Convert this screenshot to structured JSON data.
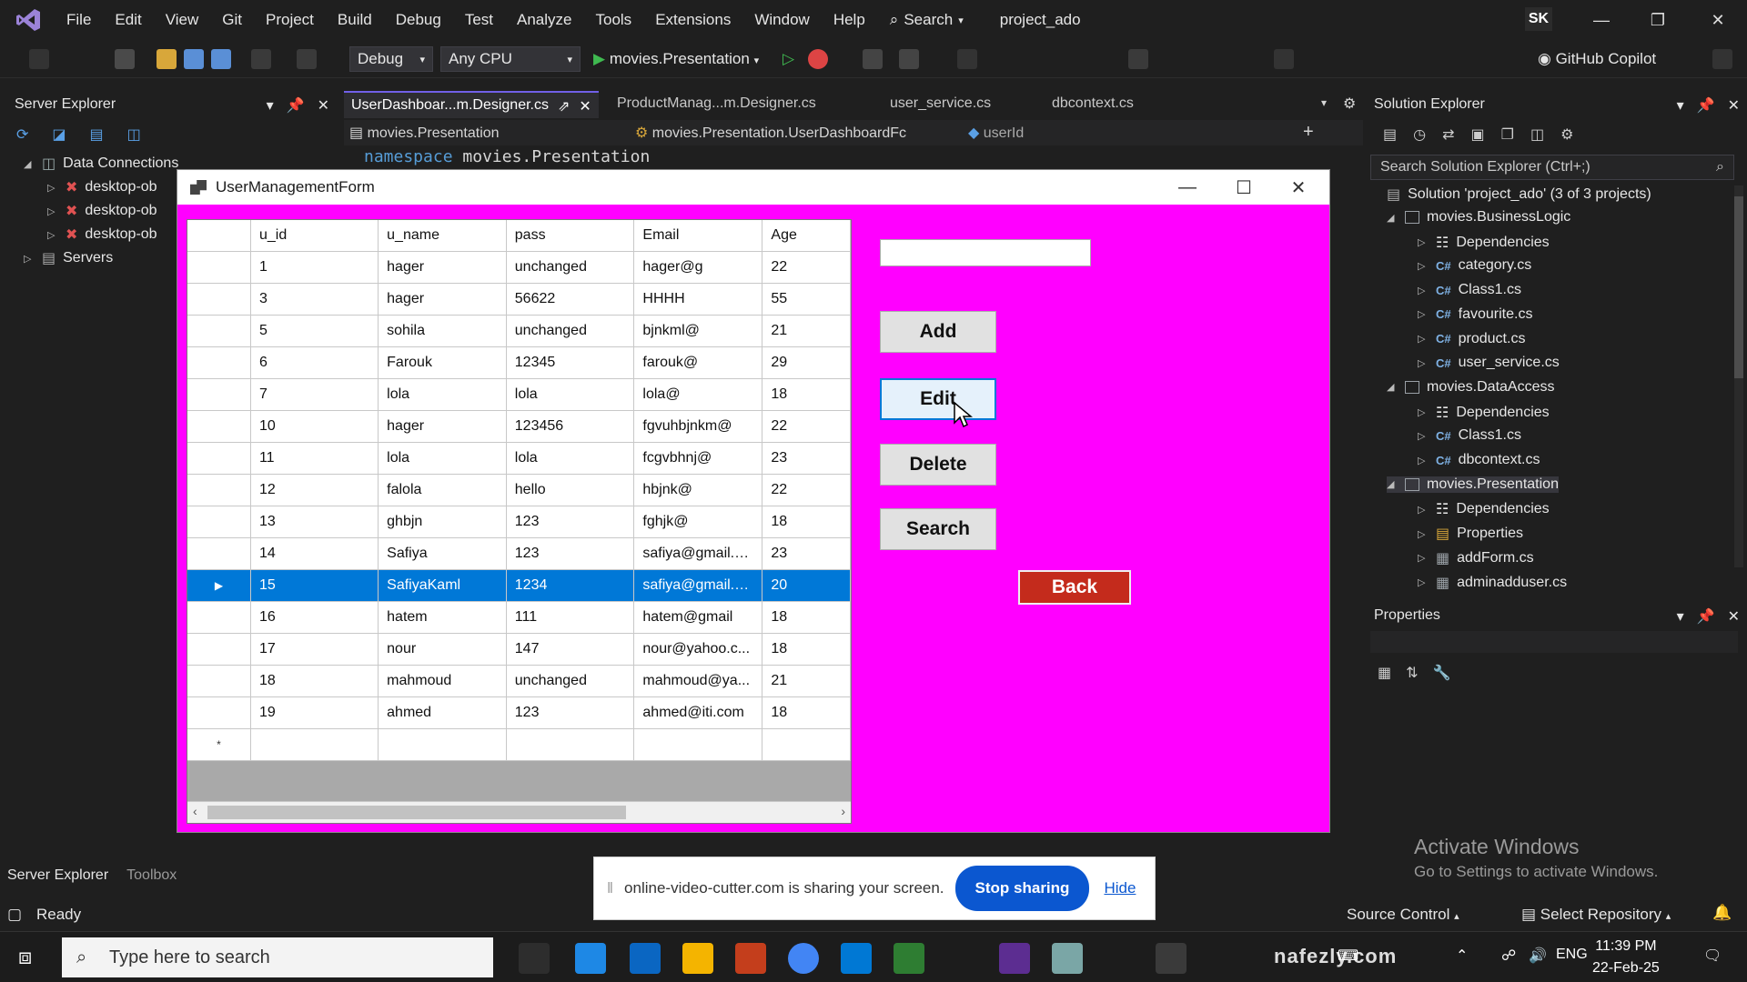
{
  "menu": {
    "items": [
      "File",
      "Edit",
      "View",
      "Git",
      "Project",
      "Build",
      "Debug",
      "Test",
      "Analyze",
      "Tools",
      "Extensions",
      "Window",
      "Help"
    ],
    "search_label": "Search",
    "project_title": "project_ado",
    "user_initials": "SK"
  },
  "toolbar": {
    "config": "Debug",
    "platform": "Any CPU",
    "startup_project": "movies.Presentation",
    "copilot": "GitHub Copilot"
  },
  "server_explorer": {
    "title": "Server Explorer",
    "data_connections": "Data Connections",
    "connections": [
      "desktop-ob",
      "desktop-ob",
      "desktop-ob"
    ],
    "servers": "Servers"
  },
  "editor": {
    "tabs": [
      "UserDashboar...m.Designer.cs",
      "ProductManag...m.Designer.cs",
      "user_service.cs",
      "dbcontext.cs"
    ],
    "nav_project": "movies.Presentation",
    "nav_class": "movies.Presentation.UserDashboardFc",
    "nav_member": "userId",
    "code_keyword": "namespace",
    "code_name": "movies.Presentation"
  },
  "solution_explorer": {
    "title": "Solution Explorer",
    "search_placeholder": "Search Solution Explorer (Ctrl+;)",
    "solution": "Solution 'project_ado' (3 of 3 projects)",
    "items": [
      {
        "label": "movies.BusinessLogic",
        "kind": "project"
      },
      {
        "label": "Dependencies",
        "kind": "deps"
      },
      {
        "label": "category.cs",
        "kind": "cs"
      },
      {
        "label": "Class1.cs",
        "kind": "cs"
      },
      {
        "label": "favourite.cs",
        "kind": "cs"
      },
      {
        "label": "product.cs",
        "kind": "cs"
      },
      {
        "label": "user_service.cs",
        "kind": "cs"
      },
      {
        "label": "movies.DataAccess",
        "kind": "project"
      },
      {
        "label": "Dependencies",
        "kind": "deps"
      },
      {
        "label": "Class1.cs",
        "kind": "cs"
      },
      {
        "label": "dbcontext.cs",
        "kind": "cs"
      },
      {
        "label": "movies.Presentation",
        "kind": "project"
      },
      {
        "label": "Dependencies",
        "kind": "deps"
      },
      {
        "label": "Properties",
        "kind": "folder"
      },
      {
        "label": "addForm.cs",
        "kind": "form"
      },
      {
        "label": "adminadduser.cs",
        "kind": "form"
      }
    ]
  },
  "properties": {
    "title": "Properties"
  },
  "activate_windows": {
    "line1": "Activate Windows",
    "line2": "Go to Settings to activate Windows."
  },
  "bottom_tabs": [
    "Server Explorer",
    "Toolbox"
  ],
  "status": {
    "ready": "Ready",
    "source_control": "Source Control",
    "select_repo": "Select Repository"
  },
  "form": {
    "title": "UserManagementForm",
    "columns": [
      "u_id",
      "u_name",
      "pass",
      "Email",
      "Age"
    ],
    "rows": [
      [
        "1",
        "hager",
        "unchanged",
        "hager@g",
        "22"
      ],
      [
        "3",
        "hager",
        "56622",
        "HHHH",
        "55"
      ],
      [
        "5",
        "sohila",
        "unchanged",
        "bjnkml@",
        "21"
      ],
      [
        "6",
        "Farouk",
        "12345",
        "farouk@",
        "29"
      ],
      [
        "7",
        "lola",
        "lola",
        "lola@",
        "18"
      ],
      [
        "10",
        "hager",
        "123456",
        "fgvuhbjnkm@",
        "22"
      ],
      [
        "11",
        "lola",
        "lola",
        "fcgvbhnj@",
        "23"
      ],
      [
        "12",
        "falola",
        "hello",
        "hbjnk@",
        "22"
      ],
      [
        "13",
        "ghbjn",
        "123",
        "fghjk@",
        "18"
      ],
      [
        "14",
        "Safiya",
        "123",
        "safiya@gmail.c...",
        "23"
      ],
      [
        "15",
        "SafiyaKaml",
        "1234",
        "safiya@gmail.c...",
        "20"
      ],
      [
        "16",
        "hatem",
        "111",
        "hatem@gmail",
        "18"
      ],
      [
        "17",
        "nour",
        "147",
        "nour@yahoo.c...",
        "18"
      ],
      [
        "18",
        "mahmoud",
        "unchanged",
        "mahmoud@ya...",
        "21"
      ],
      [
        "19",
        "ahmed",
        "123",
        "ahmed@iti.com",
        "18"
      ]
    ],
    "selected_row_index": 10,
    "input_value": "",
    "buttons": {
      "add": "Add",
      "edit": "Edit",
      "delete": "Delete",
      "search": "Search",
      "back": "Back"
    }
  },
  "share_banner": {
    "text": "online-video-cutter.com is sharing your screen.",
    "stop": "Stop sharing",
    "hide": "Hide"
  },
  "taskbar": {
    "search_placeholder": "Type here to search",
    "lang": "ENG",
    "time": "11:39 PM",
    "date": "22-Feb-25"
  },
  "watermark": "nafezly.com",
  "colors": {
    "form_bg": "#ff00ff",
    "selection": "#0078d7",
    "back_button": "#c42b1c",
    "vs_accent": "#7160e8"
  }
}
